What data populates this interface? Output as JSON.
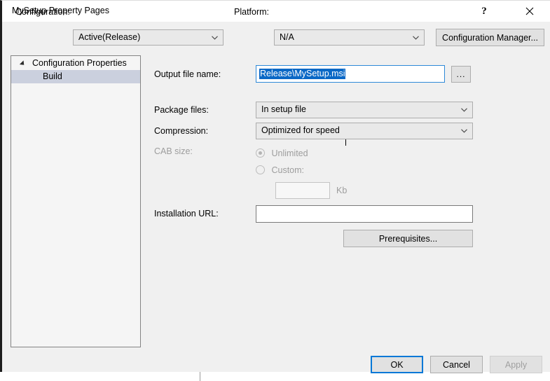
{
  "window": {
    "title": "MySetup Property Pages",
    "help_icon": "question-mark-icon",
    "close_icon": "close-icon"
  },
  "config_bar": {
    "configuration_label": "Configuration:",
    "configuration_value": "Active(Release)",
    "platform_label": "Platform:",
    "platform_value": "N/A",
    "configuration_manager_label": "Configuration Manager..."
  },
  "tree": {
    "root_label": "Configuration Properties",
    "child_label": "Build",
    "expander_icon": "triangle-expanded-icon"
  },
  "form": {
    "output_file": {
      "label": "Output file name:",
      "value": "Release\\MySetup.msi",
      "browse_label": "...",
      "selected": true
    },
    "package_files": {
      "label": "Package files:",
      "value": "In setup file",
      "chevron_icon": "chevron-down-icon"
    },
    "compression": {
      "label": "Compression:",
      "value": "Optimized for speed",
      "chevron_icon": "chevron-down-icon"
    },
    "cab_size": {
      "label": "CAB size:",
      "disabled": true,
      "unlimited_label": "Unlimited",
      "unlimited_selected": true,
      "custom_label": "Custom:",
      "custom_selected": false,
      "custom_value": "",
      "unit_label": "Kb"
    },
    "installation_url": {
      "label": "Installation URL:",
      "value": "",
      "placeholder": ""
    },
    "prerequisites_label": "Prerequisites..."
  },
  "footer": {
    "ok_label": "OK",
    "cancel_label": "Cancel",
    "apply_label": "Apply",
    "apply_disabled": true
  },
  "colors": {
    "dialog_background": "#f0f0f0",
    "accent_focus": "#0078d7",
    "text_selection": "#0a68c6",
    "tree_selection": "#cbd0de",
    "disabled_text": "#9d9d9d"
  }
}
